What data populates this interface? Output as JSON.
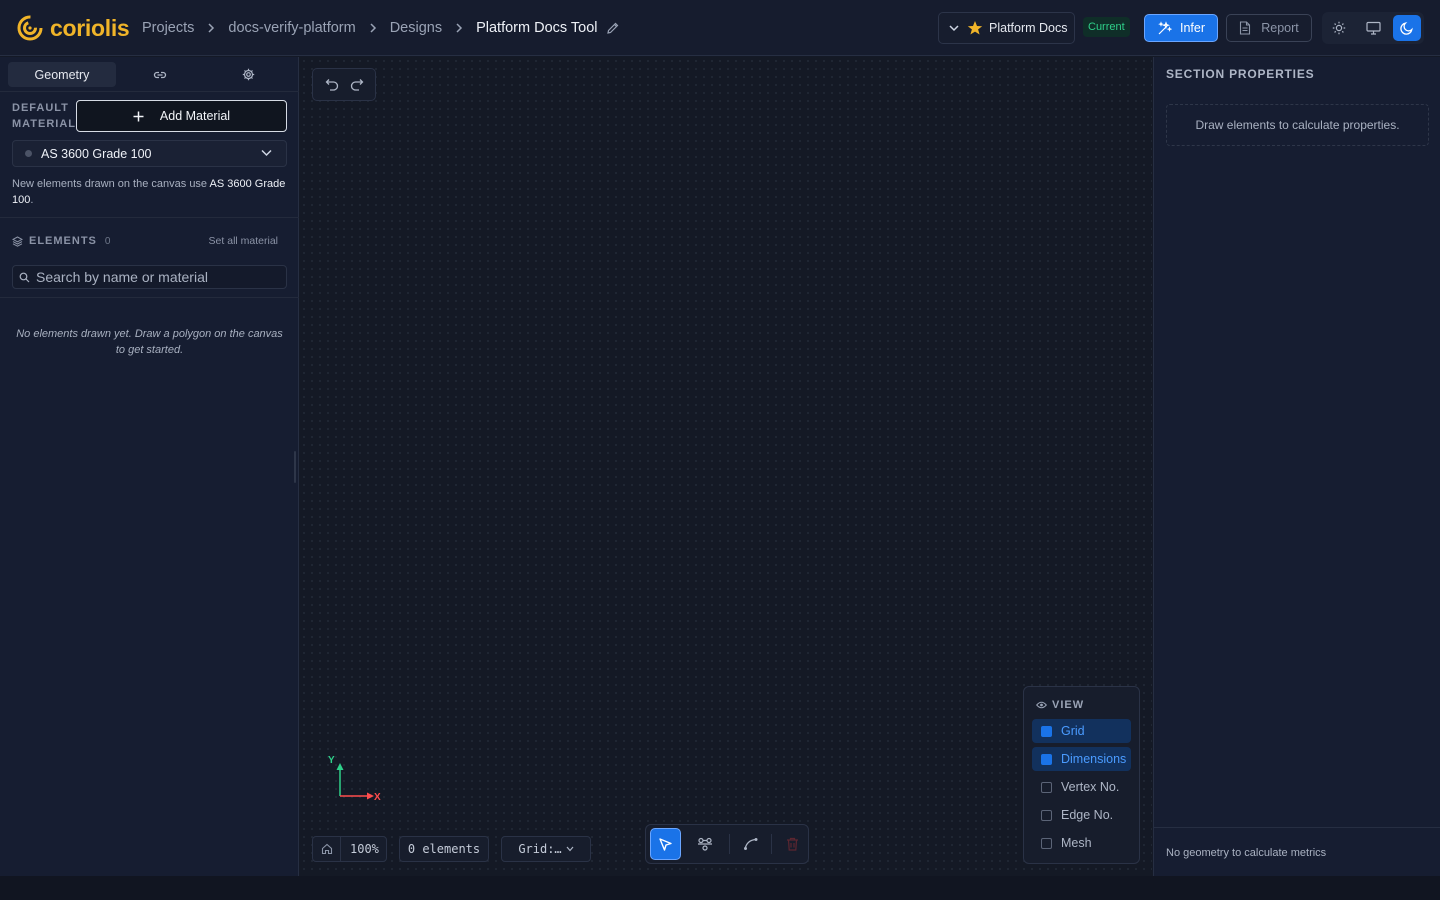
{
  "app": {
    "name": "coriolis",
    "brand_color": "#f0b429",
    "accent_color": "#1a73e8"
  },
  "breadcrumb": {
    "items": [
      "Projects",
      "docs-verify-platform",
      "Designs"
    ],
    "current": "Platform Docs Tool"
  },
  "header": {
    "version_name": "Platform Docs",
    "version_status": "Current",
    "infer_label": "Infer",
    "report_label": "Report",
    "theme_active": "dark"
  },
  "left_panel": {
    "tabs": {
      "geometry_label": "Geometry"
    },
    "default_material_label": "DEFAULT MATERIAL",
    "add_material_label": "Add Material",
    "selected_material": "AS 3600 Grade 100",
    "note_prefix": "New elements drawn on the canvas use ",
    "note_material": "AS 3600 Grade 100",
    "note_suffix": ".",
    "elements_label": "ELEMENTS",
    "elements_count": "0",
    "set_all_label": "Set all material",
    "search_placeholder": "Search by name or material",
    "empty_message": "No elements drawn yet. Draw a polygon on the canvas to get started."
  },
  "canvas": {
    "axis": {
      "x_label": "X",
      "y_label": "Y"
    },
    "zoom": "100%",
    "element_count": "0 elements",
    "grid_label": "Grid:…",
    "active_tool": "select",
    "view": {
      "title": "VIEW",
      "options": [
        {
          "label": "Grid",
          "checked": true
        },
        {
          "label": "Dimensions",
          "checked": true
        },
        {
          "label": "Vertex No.",
          "checked": false
        },
        {
          "label": "Edge No.",
          "checked": false
        },
        {
          "label": "Mesh",
          "checked": false
        }
      ]
    }
  },
  "right_panel": {
    "title": "SECTION PROPERTIES",
    "empty_message": "Draw elements to calculate properties.",
    "footer_message": "No geometry to calculate metrics"
  }
}
